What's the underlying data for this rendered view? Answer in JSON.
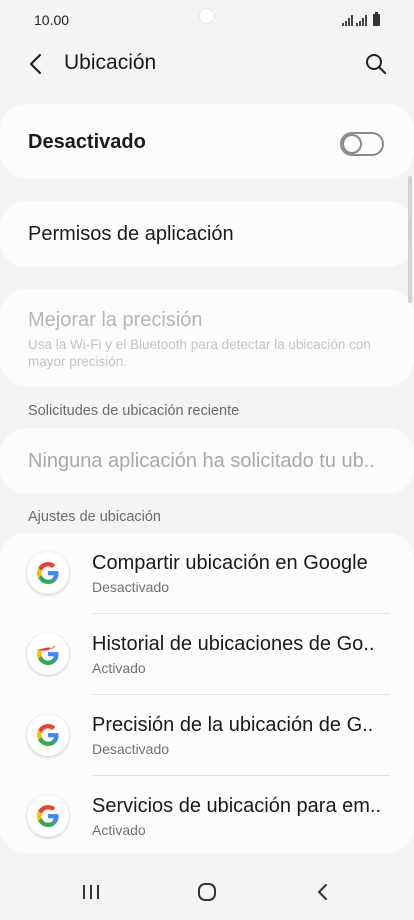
{
  "status_bar": {
    "time": "10.00"
  },
  "header": {
    "title": "Ubicación"
  },
  "location_toggle": {
    "label": "Desactivado",
    "state": "off"
  },
  "permisos": {
    "label": "Permisos de aplicación"
  },
  "mejorar": {
    "title": "Mejorar la precisión",
    "description": "Usa la Wi-Fi y el Bluetooth para detectar la ubicación con mayor precisión."
  },
  "recent_requests": {
    "header": "Solicitudes de ubicación reciente",
    "empty_text": "Ninguna aplicación ha solicitado tu ub.."
  },
  "location_settings": {
    "header": "Ajustes de ubicación",
    "items": [
      {
        "title": "Compartir ubicación en Google",
        "subtitle": "Desactivado",
        "icon": "google-icon"
      },
      {
        "title": "Historial de ubicaciones de Go..",
        "subtitle": "Activado",
        "icon": "google-icon"
      },
      {
        "title": "Precisión de la ubicación de G..",
        "subtitle": "Desactivado",
        "icon": "google-icon"
      },
      {
        "title": "Servicios de ubicación para em..",
        "subtitle": "Activado",
        "icon": "google-icon"
      }
    ]
  },
  "colors": {
    "background": "#f4f4f4",
    "card": "#fcfcfc",
    "disabled_text": "#b5b5b5",
    "google_blue": "#4285F4",
    "google_red": "#EA4335",
    "google_yellow": "#FBBC05",
    "google_green": "#34A853"
  }
}
